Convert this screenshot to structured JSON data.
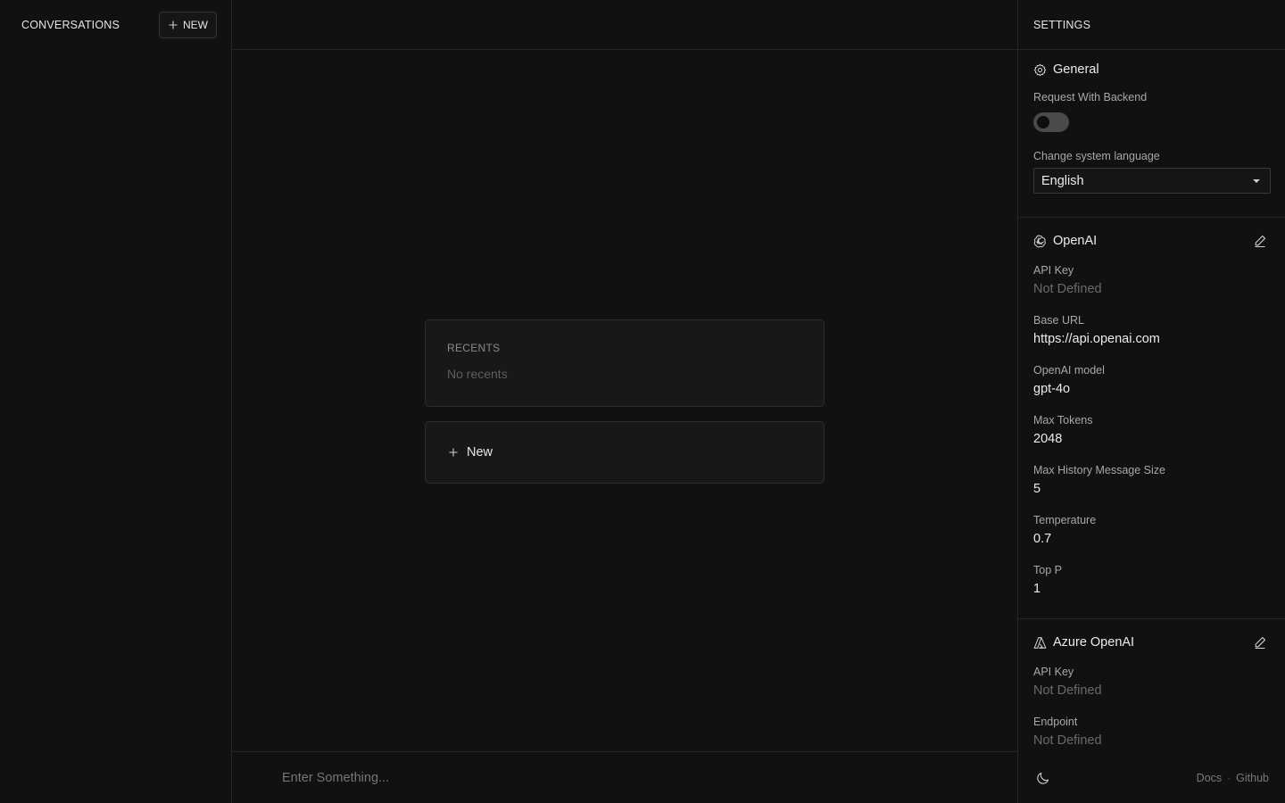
{
  "sidebar": {
    "title": "CONVERSATIONS",
    "new_button": "NEW"
  },
  "main": {
    "recents": {
      "label": "RECENTS",
      "empty_text": "No recents"
    },
    "new_card_label": "New",
    "composer": {
      "placeholder": "Enter Something..."
    }
  },
  "settings": {
    "title": "SETTINGS",
    "general": {
      "title": "General",
      "request_backend_label": "Request With Backend",
      "request_backend_enabled": false,
      "language_label": "Change system language",
      "language_value": "English"
    },
    "openai": {
      "title": "OpenAI",
      "fields": [
        {
          "label": "API Key",
          "value": "Not Defined"
        },
        {
          "label": "Base URL",
          "value": "https://api.openai.com"
        },
        {
          "label": "OpenAI model",
          "value": "gpt-4o"
        },
        {
          "label": "Max Tokens",
          "value": "2048"
        },
        {
          "label": "Max History Message Size",
          "value": "5"
        },
        {
          "label": "Temperature",
          "value": "0.7"
        },
        {
          "label": "Top P",
          "value": "1"
        }
      ]
    },
    "azure": {
      "title": "Azure OpenAI",
      "fields": [
        {
          "label": "API Key",
          "value": "Not Defined"
        },
        {
          "label": "Endpoint",
          "value": "Not Defined"
        }
      ]
    },
    "footer": {
      "docs_link": "Docs",
      "separator": "·",
      "github_link": "Github"
    }
  },
  "icons": {
    "plus": "plus-icon",
    "gear": "gear-icon",
    "openai": "openai-logo-icon",
    "azure": "azure-logo-icon",
    "edit": "edit-icon",
    "moon": "moon-icon",
    "caret": "caret-down-icon"
  },
  "colors": {
    "background": "#111111",
    "border": "#262626",
    "muted_text": "#6a6a6a",
    "toggle_off": "#4a4a4a"
  }
}
